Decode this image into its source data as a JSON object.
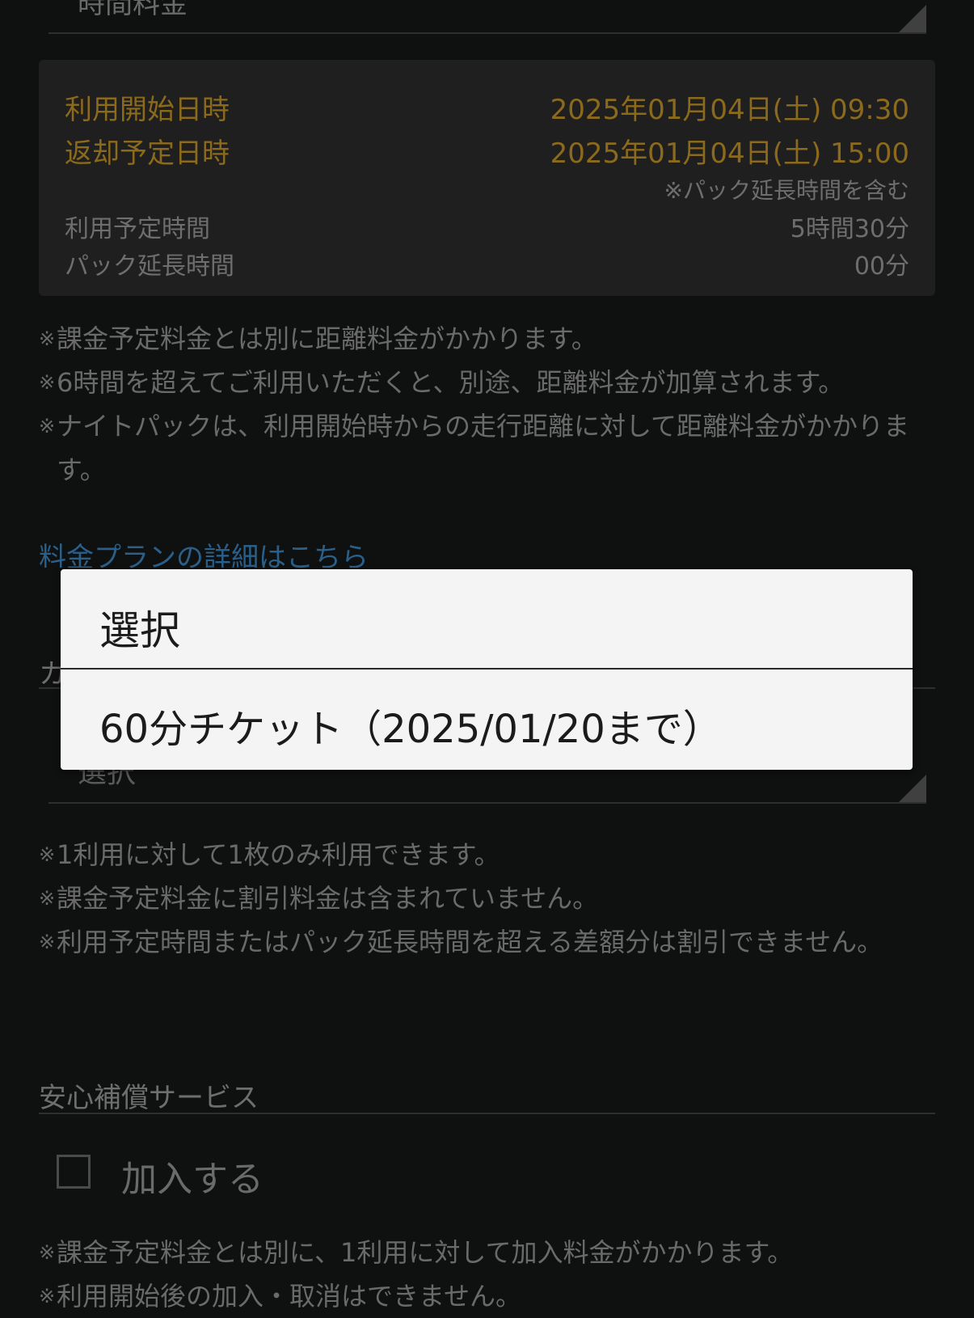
{
  "top_select": {
    "label": "時間料金"
  },
  "reservation": {
    "start_label": "利用開始日時",
    "start_value": "2025年01月04日(土) 09:30",
    "return_label": "返却予定日時",
    "return_value": "2025年01月04日(土) 15:00",
    "pack_note": "※パック延長時間を含む",
    "planned_label": "利用予定時間",
    "planned_value": "5時間30分",
    "extension_label": "パック延長時間",
    "extension_value": "00分"
  },
  "pricing_notes": [
    "課金予定料金とは別に距離料金がかかります。",
    "6時間を超えてご利用いただくと、別途、距離料金が加算されます。",
    "ナイトパックは、利用開始時からの走行距離に対して距離料金がかかります。"
  ],
  "pricing_link": "料金プランの詳細はこちら",
  "coupon": {
    "section_label": "カ",
    "select_value": "選択",
    "notes": [
      "1利用に対して1枚のみ利用できます。",
      "課金予定料金に割引料金は含まれていません。",
      "利用予定時間またはパック延長時間を超える差額分は割引できません。"
    ]
  },
  "insurance": {
    "section_label": "安心補償サービス",
    "checkbox_label": "加入する",
    "notes": [
      "課金予定料金とは別に、1利用に対して加入料金がかかります。",
      "利用開始後の加入・取消はできません。"
    ]
  },
  "note_mark": "※",
  "dialog": {
    "title": "選択",
    "options": [
      "60分チケット（2025/01/20まで）"
    ]
  },
  "colors": {
    "background": "#0f1010",
    "panel": "#1f1f1f",
    "gold_text": "#8c6a1c",
    "link": "#2a5f8a",
    "dialog_bg": "#f4f4f4"
  }
}
